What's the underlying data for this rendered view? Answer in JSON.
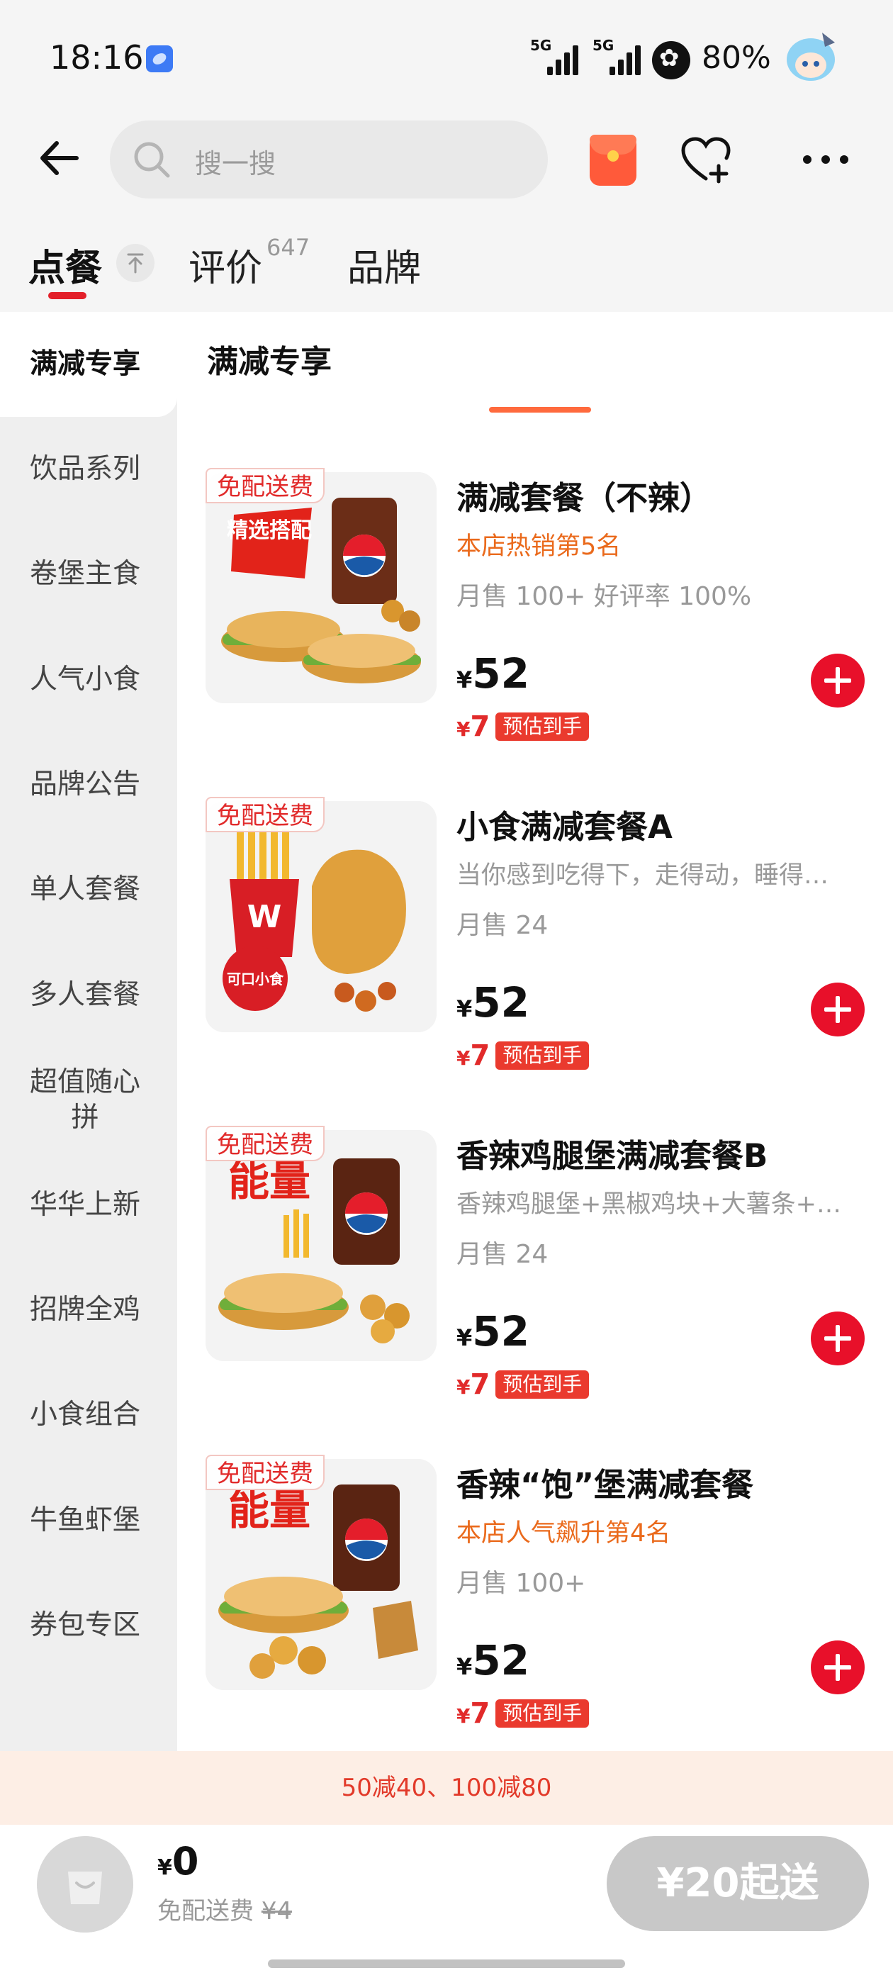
{
  "status": {
    "time": "18:16",
    "signal1": "5G",
    "signal2": "5G",
    "battery": "80%"
  },
  "header": {
    "search_placeholder": "搜一搜"
  },
  "tabs": {
    "order": "点餐",
    "review": "评价",
    "review_count": "647",
    "brand": "品牌"
  },
  "sidebar": {
    "items": [
      "满减专享",
      "饮品系列",
      "卷堡主食",
      "人气小食",
      "品牌公告",
      "单人套餐",
      "多人套餐",
      "超值随心拼",
      "华华上新",
      "招牌全鸡",
      "小食组合",
      "牛鱼虾堡",
      "券包专区"
    ]
  },
  "section": {
    "title": "满减专享"
  },
  "products": [
    {
      "tag": "免配送费",
      "name": "满减套餐（不辣）",
      "sub": "本店热销第5名",
      "sales": "月售 100+ 好评率 100%",
      "yen": "¥",
      "price": "52",
      "est_price": "7",
      "est_label": "预估到手",
      "img_text": "精选搭配"
    },
    {
      "tag": "免配送费",
      "name": "小食满减套餐A",
      "sub": "当你感到吃得下，走得动，睡得…",
      "sales": "月售 24",
      "yen": "¥",
      "price": "52",
      "est_price": "7",
      "est_label": "预估到手",
      "img_text": "可口小食"
    },
    {
      "tag": "免配送费",
      "name": "香辣鸡腿堡满减套餐B",
      "sub": "香辣鸡腿堡+黑椒鸡块+大薯条+…",
      "sales": "月售 24",
      "yen": "¥",
      "price": "52",
      "est_price": "7",
      "est_label": "预估到手",
      "img_text": "能量"
    },
    {
      "tag": "免配送费",
      "name": "香辣“饱”堡满减套餐",
      "sub": "本店人气飙升第4名",
      "sales": "月售 100+",
      "yen": "¥",
      "price": "52",
      "est_price": "7",
      "est_label": "预估到手",
      "img_text": "能量"
    }
  ],
  "promo": "50减40、100减80",
  "cart": {
    "yen": "¥",
    "total": "0",
    "fee_label": "免配送费",
    "fee_original": "¥4",
    "checkout": "¥20起送"
  },
  "colors": {
    "accent": "#e8102a",
    "rank": "#ea6a1c",
    "promo_bg": "#fdeee5"
  }
}
